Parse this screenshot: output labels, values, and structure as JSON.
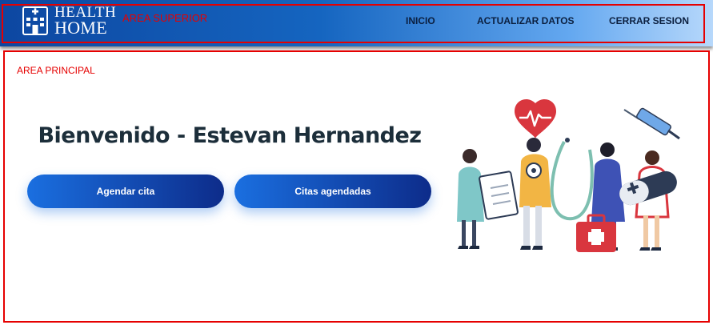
{
  "header": {
    "logo_line1": "HEALTH",
    "logo_line2": "HOME",
    "area_label": "AREA SUPERIOR",
    "nav": {
      "inicio": "INICIO",
      "actualizar": "ACTUALIZAR DATOS",
      "cerrar": "CERRAR SESION"
    }
  },
  "main": {
    "area_label": "AREA PRINCIPAL",
    "welcome": "Bienvenido - Estevan Hernandez",
    "buttons": {
      "agendar": "Agendar cita",
      "citas": "Citas agendadas"
    }
  },
  "colors": {
    "header_start": "#0d47a1",
    "header_end": "#b7d8fb",
    "button_start": "#1a6fe0",
    "button_end": "#0d2c8a",
    "frame_red": "#e60000"
  },
  "icons": {
    "logo": "hospital-building-icon",
    "illustration": "medical-staff-illustration"
  }
}
